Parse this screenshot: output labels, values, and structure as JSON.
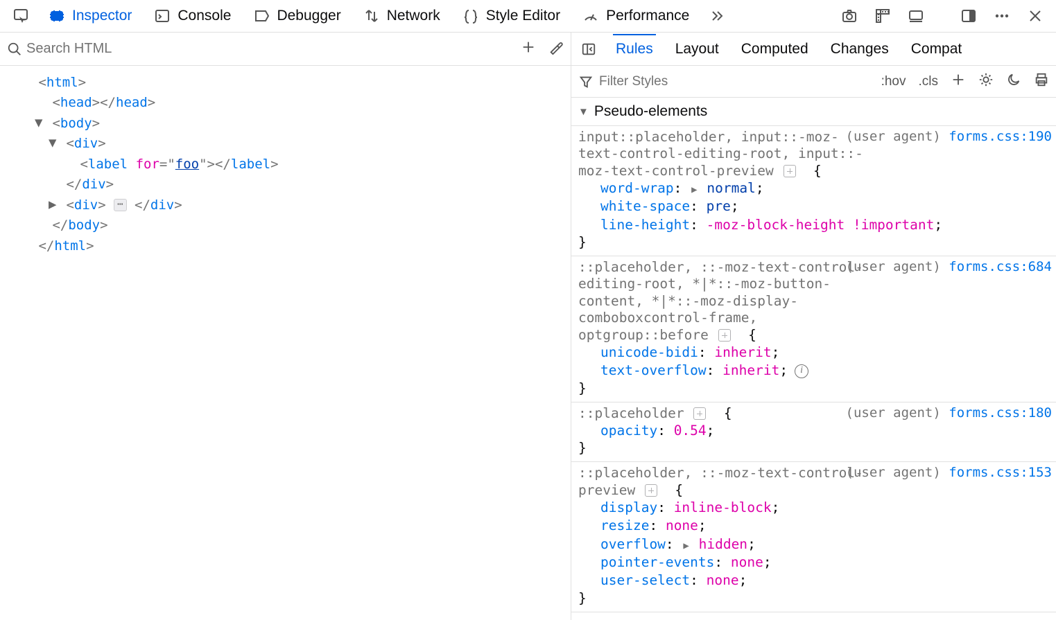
{
  "toolbar": {
    "tabs": [
      {
        "id": "inspector",
        "label": "Inspector",
        "active": true
      },
      {
        "id": "console",
        "label": "Console",
        "active": false
      },
      {
        "id": "debugger",
        "label": "Debugger",
        "active": false
      },
      {
        "id": "network",
        "label": "Network",
        "active": false
      },
      {
        "id": "styleeditor",
        "label": "Style Editor",
        "active": false
      },
      {
        "id": "performance",
        "label": "Performance",
        "active": false
      }
    ]
  },
  "left": {
    "search_placeholder": "Search HTML",
    "dom": {
      "html_open": "html",
      "head": "head",
      "body": "body",
      "div": "div",
      "label": "label",
      "label_attr_name": "for",
      "label_attr_value": "foo",
      "ellipsis": "⋯"
    }
  },
  "right": {
    "tabs": [
      {
        "id": "rules",
        "label": "Rules",
        "active": true
      },
      {
        "id": "layout",
        "label": "Layout",
        "active": false
      },
      {
        "id": "computed",
        "label": "Computed",
        "active": false
      },
      {
        "id": "changes",
        "label": "Changes",
        "active": false
      },
      {
        "id": "compat",
        "label": "Compat",
        "active": false
      }
    ],
    "filter_placeholder": "Filter Styles",
    "hov": ":hov",
    "cls": ".cls",
    "pseudo_header": "Pseudo-elements"
  },
  "rules": [
    {
      "selector": "input::placeholder, input::-moz-text-control-editing-root, input::-moz-text-control-preview",
      "ua": true,
      "ua_text": "(user agent)",
      "source": "forms.css:190",
      "decls": [
        {
          "prop": "word-wrap",
          "val": "normal",
          "arrow": true
        },
        {
          "prop": "white-space",
          "val": "pre"
        },
        {
          "prop": "line-height",
          "val": "-moz-block-height !important",
          "magenta": true
        }
      ]
    },
    {
      "selector": "::placeholder, ::-moz-text-control-editing-root, *|*::-moz-button-content, *|*::-moz-display-comboboxcontrol-frame, optgroup::before",
      "ua": true,
      "ua_text": "(user agent)",
      "source": "forms.css:684",
      "decls": [
        {
          "prop": "unicode-bidi",
          "val": "inherit",
          "magenta": true
        },
        {
          "prop": "text-overflow",
          "val": "inherit",
          "magenta": true,
          "info": true
        }
      ]
    },
    {
      "selector": "::placeholder",
      "ua": true,
      "ua_text": "(user agent)",
      "source": "forms.css:180",
      "decls": [
        {
          "prop": "opacity",
          "val": "0.54",
          "magenta": true
        }
      ]
    },
    {
      "selector": "::placeholder, ::-moz-text-control-preview",
      "ua": true,
      "ua_text": "(user agent)",
      "source": "forms.css:153",
      "decls": [
        {
          "prop": "display",
          "val": "inline-block",
          "magenta": true
        },
        {
          "prop": "resize",
          "val": "none",
          "magenta": true
        },
        {
          "prop": "overflow",
          "val": "hidden",
          "arrow": true,
          "magenta": true
        },
        {
          "prop": "pointer-events",
          "val": "none",
          "magenta": true
        },
        {
          "prop": "user-select",
          "val": "none",
          "magenta": true
        }
      ]
    }
  ]
}
